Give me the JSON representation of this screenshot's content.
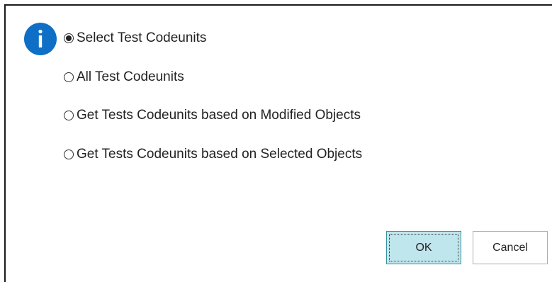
{
  "dialog": {
    "icon": "info-icon",
    "accent_color": "#0f6fc6",
    "options": [
      {
        "label": "Select Test Codeunits",
        "selected": true
      },
      {
        "label": "All Test Codeunits",
        "selected": false
      },
      {
        "label": "Get Tests Codeunits based on Modified Objects",
        "selected": false
      },
      {
        "label": "Get Tests Codeunits based on Selected Objects",
        "selected": false
      }
    ],
    "ok_label": "OK",
    "cancel_label": "Cancel"
  }
}
